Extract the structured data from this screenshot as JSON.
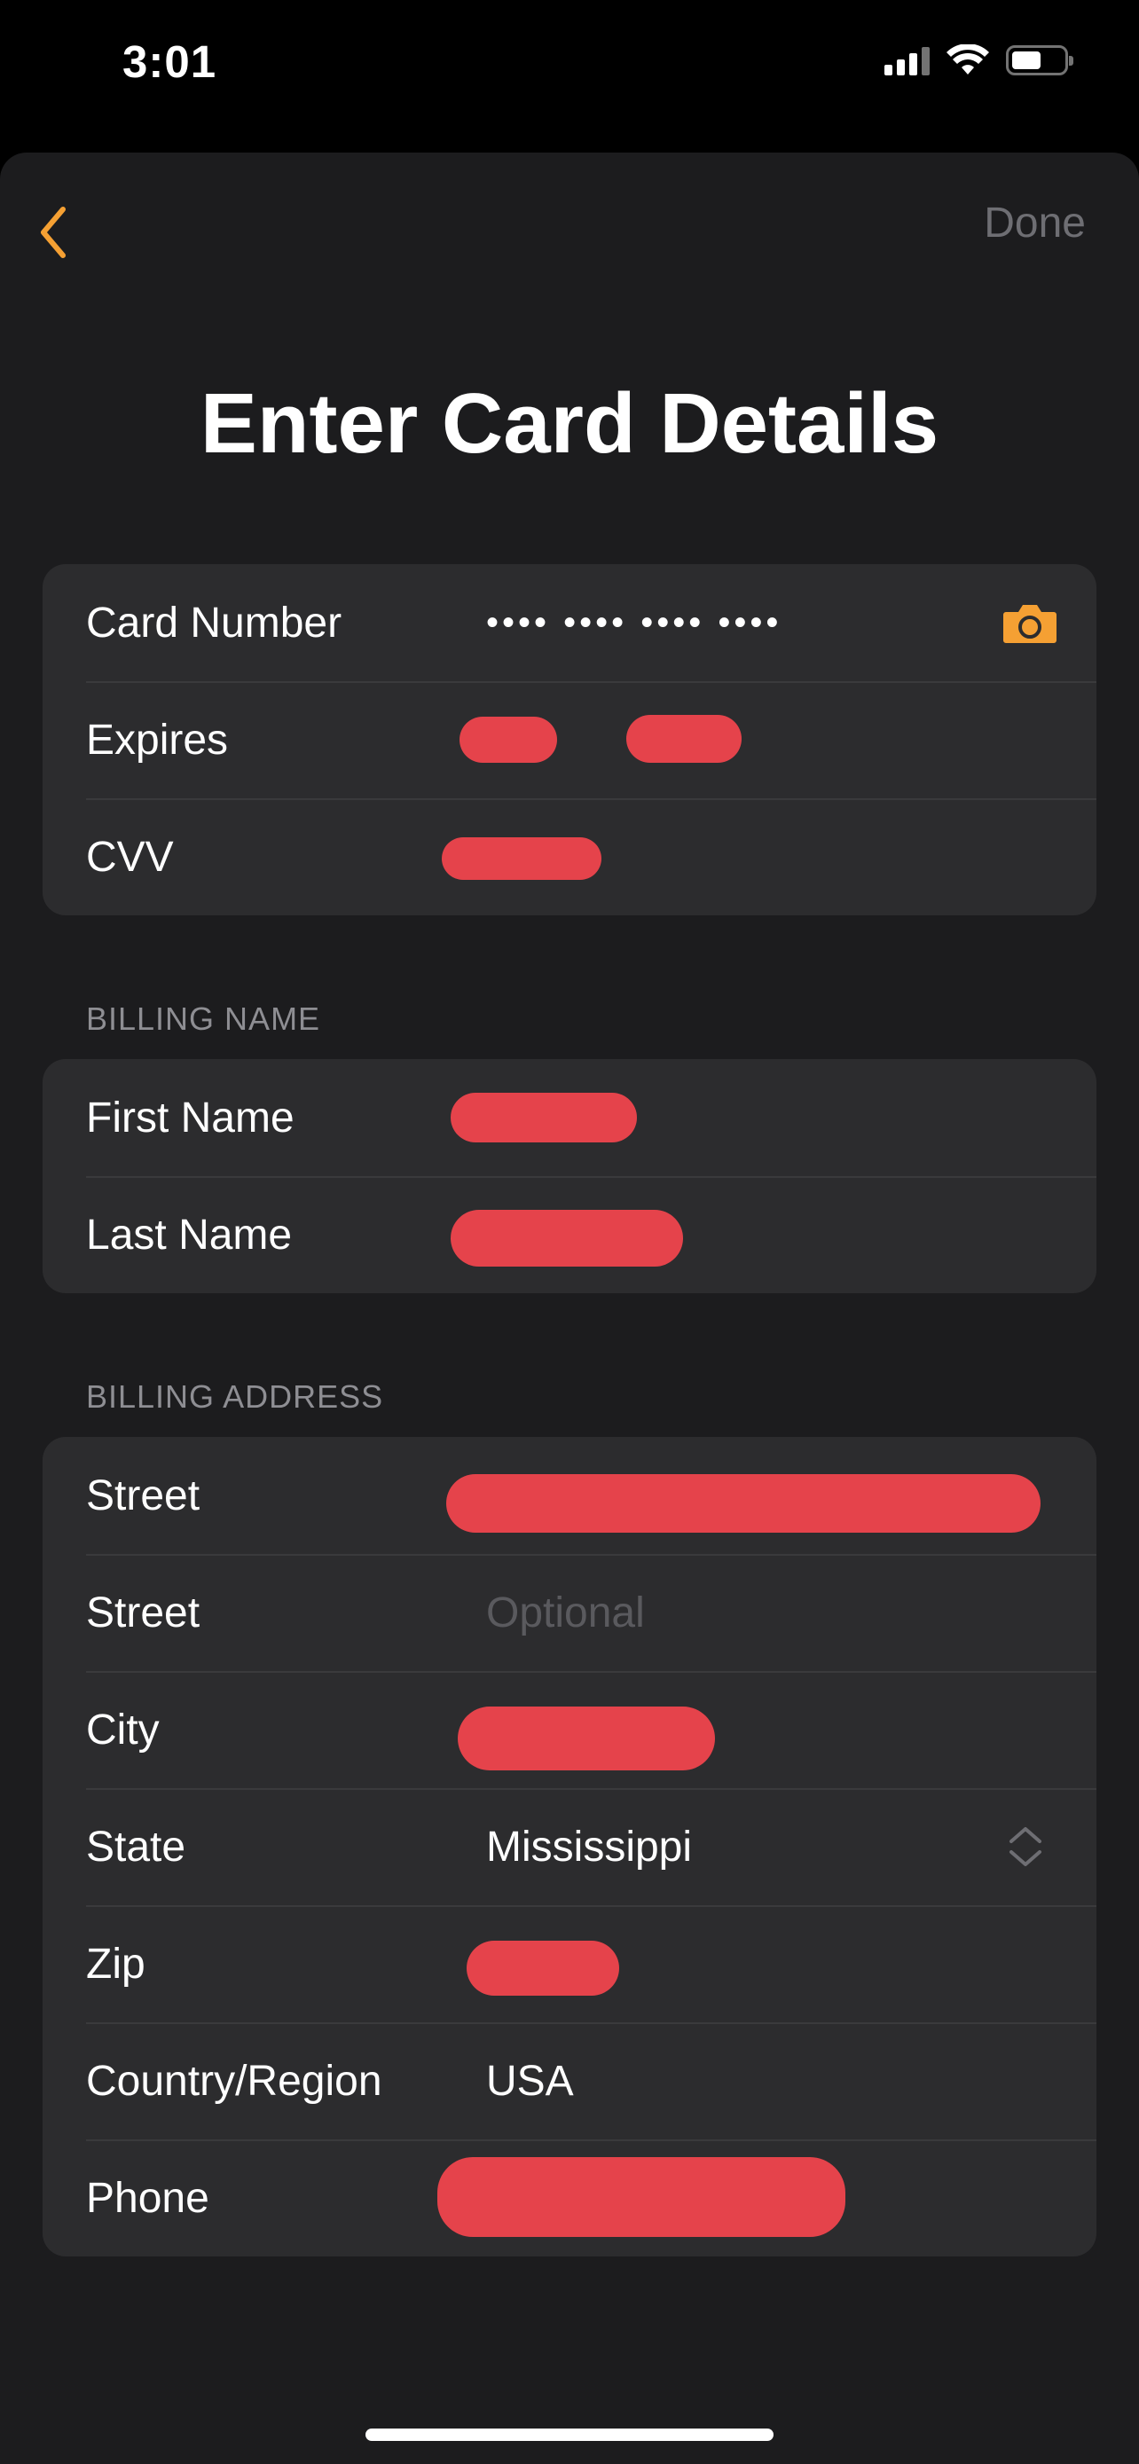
{
  "status_bar": {
    "time": "3:01",
    "icons": [
      "cellular-signal-icon",
      "wifi-icon",
      "battery-icon"
    ]
  },
  "nav": {
    "back_icon": "chevron-left-icon",
    "done_label": "Done"
  },
  "title": "Enter Card Details",
  "card": {
    "card_number_label": "Card Number",
    "card_number_value": "•••• •••• •••• ••••",
    "camera_icon": "camera-icon",
    "expires_label": "Expires",
    "expires_separator": "/",
    "cvv_label": "CVV"
  },
  "billing_name": {
    "header": "BILLING NAME",
    "first_name_label": "First Name",
    "last_name_label": "Last Name"
  },
  "billing_address": {
    "header": "BILLING ADDRESS",
    "street_label": "Street",
    "street2_label": "Street",
    "street2_placeholder": "Optional",
    "city_label": "City",
    "state_label": "State",
    "state_value": "Mississippi",
    "state_icon": "chevron-up-down-icon",
    "zip_label": "Zip",
    "country_label": "Country/Region",
    "country_value": "USA",
    "phone_label": "Phone"
  },
  "colors": {
    "accent": "#f5a033",
    "background": "#1c1c1e",
    "group_background": "#2c2c2e",
    "redaction": "#e5434b"
  }
}
